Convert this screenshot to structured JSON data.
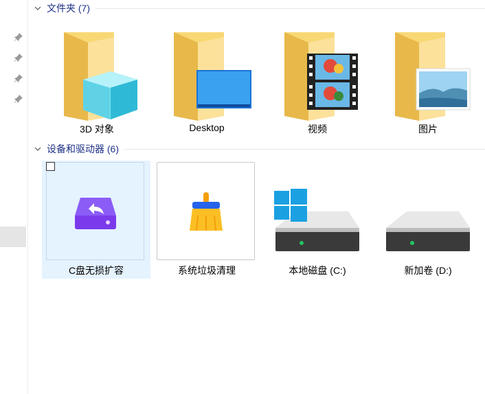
{
  "groups": {
    "folders": {
      "title": "文件夹 (7)"
    },
    "devices": {
      "title": "设备和驱动器 (6)"
    }
  },
  "folders": [
    {
      "label": "3D 对象",
      "icon": "3d-objects-folder-icon"
    },
    {
      "label": "Desktop",
      "icon": "desktop-folder-icon"
    },
    {
      "label": "视频",
      "icon": "videos-folder-icon"
    },
    {
      "label": "图片",
      "icon": "pictures-folder-icon"
    }
  ],
  "devices": [
    {
      "label": "C盘无损扩容",
      "icon": "disk-expand-app-icon",
      "selected": true
    },
    {
      "label": "系统垃圾清理",
      "icon": "broom-cleanup-icon"
    },
    {
      "label": "本地磁盘 (C:)",
      "icon": "windows-drive-icon"
    },
    {
      "label": "新加卷 (D:)",
      "icon": "hard-drive-icon"
    }
  ],
  "colors": {
    "group_title": "#1e3287",
    "selection_bg": "#e5f3ff",
    "folder_yellow": "#f8d775"
  }
}
